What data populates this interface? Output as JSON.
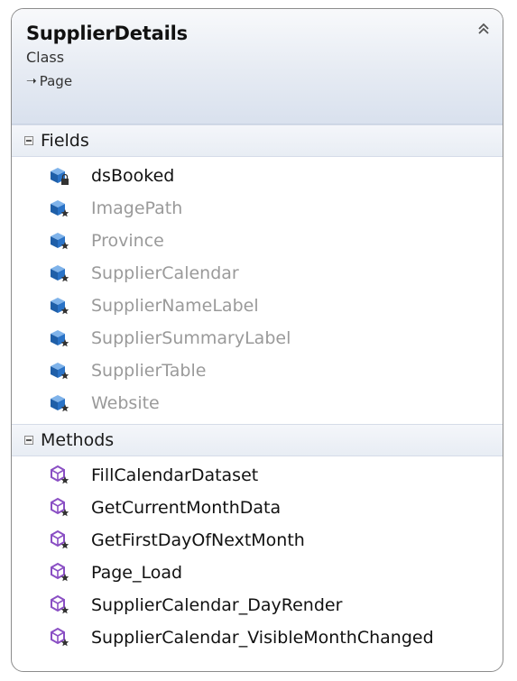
{
  "header": {
    "title": "SupplierDetails",
    "subtitle": "Class",
    "inherits": "Page",
    "collapse_icon": "double-chevron-up-icon"
  },
  "sections": {
    "fields": {
      "label": "Fields",
      "items": [
        {
          "name": "dsBooked",
          "visibility": "private-lock"
        },
        {
          "name": "ImagePath",
          "visibility": "protected"
        },
        {
          "name": "Province",
          "visibility": "protected"
        },
        {
          "name": "SupplierCalendar",
          "visibility": "protected"
        },
        {
          "name": "SupplierNameLabel",
          "visibility": "protected"
        },
        {
          "name": "SupplierSummaryLabel",
          "visibility": "protected"
        },
        {
          "name": "SupplierTable",
          "visibility": "protected"
        },
        {
          "name": "Website",
          "visibility": "protected"
        }
      ]
    },
    "methods": {
      "label": "Methods",
      "items": [
        {
          "name": "FillCalendarDataset"
        },
        {
          "name": "GetCurrentMonthData"
        },
        {
          "name": "GetFirstDayOfNextMonth"
        },
        {
          "name": "Page_Load"
        },
        {
          "name": "SupplierCalendar_DayRender"
        },
        {
          "name": "SupplierCalendar_VisibleMonthChanged"
        }
      ]
    }
  },
  "colors": {
    "field_icon": "#2a73c7",
    "method_icon": "#8a4fc4",
    "text_dim": "#9a9a9a",
    "text": "#111111"
  }
}
